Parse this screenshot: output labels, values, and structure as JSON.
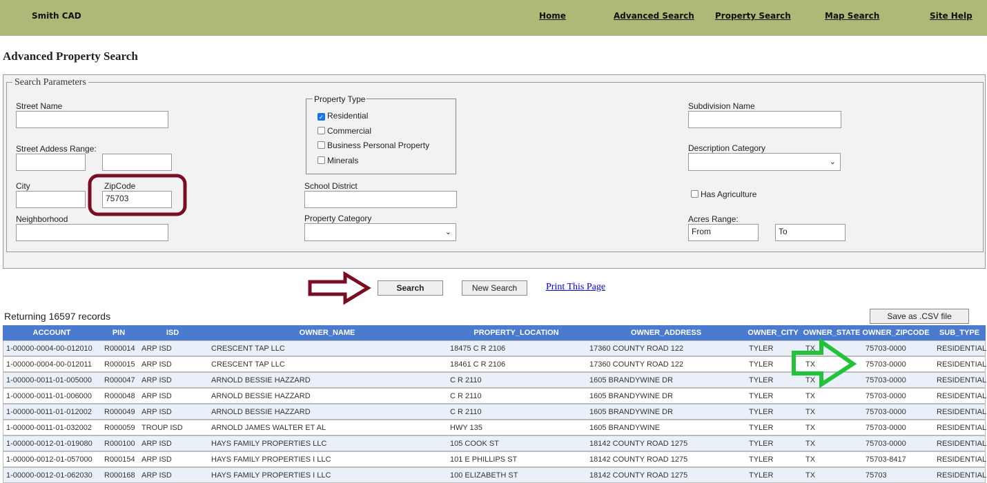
{
  "header": {
    "brand": "Smith CAD",
    "nav": [
      "Home",
      "Advanced Search",
      "Property Search",
      "Map Search",
      "Site Help"
    ]
  },
  "page_title": "Advanced Property Search",
  "form": {
    "legend": "Search Parameters",
    "street_name": {
      "label": "Street Name",
      "value": ""
    },
    "address_range": {
      "label": "Street Addess Range:",
      "from": "",
      "to": ""
    },
    "city": {
      "label": "City",
      "value": ""
    },
    "zipcode": {
      "label": "ZipCode",
      "value": "75703"
    },
    "neighborhood": {
      "label": "Neighborhood",
      "value": ""
    },
    "property_type": {
      "legend": "Property Type",
      "options": [
        {
          "label": "Residential",
          "checked": true
        },
        {
          "label": "Commercial",
          "checked": false
        },
        {
          "label": "Business Personal Property",
          "checked": false
        },
        {
          "label": "Minerals",
          "checked": false
        }
      ]
    },
    "school_district": {
      "label": "School District",
      "value": ""
    },
    "property_category": {
      "label": "Property Category",
      "value": ""
    },
    "subdivision": {
      "label": "Subdivision Name",
      "value": ""
    },
    "description_category": {
      "label": "Description Category",
      "value": ""
    },
    "has_agriculture": {
      "label": "Has Agriculture",
      "checked": false
    },
    "acres": {
      "label": "Acres Range:",
      "from_placeholder": "From",
      "to_placeholder": "To"
    }
  },
  "actions": {
    "search": "Search",
    "new_search": "New Search",
    "print": "Print This Page",
    "csv": "Save as .CSV file"
  },
  "results": {
    "count_text": "Returning 16597 records",
    "columns": [
      "ACCOUNT",
      "PIN",
      "ISD",
      "OWNER_NAME",
      "PROPERTY_LOCATION",
      "OWNER_ADDRESS",
      "OWNER_CITY",
      "OWNER_STATE",
      "OWNER_ZIPCODE",
      "SUB_TYPE"
    ],
    "rows": [
      [
        "1-00000-0004-00-012010",
        "R000014",
        "ARP ISD",
        "CRESCENT TAP LLC",
        "18475 C R 2106",
        "17360 COUNTY ROAD 122",
        "TYLER",
        "TX",
        "75703-0000",
        "RESIDENTIAL"
      ],
      [
        "1-00000-0004-00-012011",
        "R000015",
        "ARP ISD",
        "CRESCENT TAP LLC",
        "18461 C R 2106",
        "17360 COUNTY ROAD 122",
        "TYLER",
        "TX",
        "75703-0000",
        "RESIDENTIAL"
      ],
      [
        "1-00000-0011-01-005000",
        "R000047",
        "ARP ISD",
        "ARNOLD BESSIE HAZZARD",
        "C R 2110",
        "1605 BRANDYWINE DR",
        "TYLER",
        "TX",
        "75703-0000",
        "RESIDENTIAL"
      ],
      [
        "1-00000-0011-01-006000",
        "R000048",
        "ARP ISD",
        "ARNOLD BESSIE HAZZARD",
        "C R 2110",
        "1605 BRANDYWINE DR",
        "TYLER",
        "TX",
        "75703-0000",
        "RESIDENTIAL"
      ],
      [
        "1-00000-0011-01-012002",
        "R000049",
        "ARP ISD",
        "ARNOLD BESSIE HAZZARD",
        "C R 2110",
        "1605 BRANDYWINE DR",
        "TYLER",
        "TX",
        "75703-0000",
        "RESIDENTIAL"
      ],
      [
        "1-00000-0011-01-032002",
        "R000059",
        "TROUP ISD",
        "ARNOLD JAMES WALTER ET AL",
        "HWY 135",
        "1605 BRANDYWINE",
        "TYLER",
        "TX",
        "75703-0000",
        "RESIDENTIAL"
      ],
      [
        "1-00000-0012-01-019080",
        "R000100",
        "ARP ISD",
        "HAYS FAMILY PROPERTIES LLC",
        "105 COOK ST",
        "18142 COUNTY ROAD 1275",
        "TYLER",
        "TX",
        "75703-0000",
        "RESIDENTIAL"
      ],
      [
        "1-00000-0012-01-057000",
        "R000154",
        "ARP ISD",
        "HAYS FAMILY PROPERTIES I LLC",
        "101 E PHILLIPS ST",
        "18142 COUNTY ROAD 1275",
        "TYLER",
        "TX",
        "75703-8417",
        "RESIDENTIAL"
      ],
      [
        "1-00000-0012-01-062030",
        "R000168",
        "ARP ISD",
        "HAYS FAMILY PROPERTIES I LLC",
        "100 ELIZABETH ST",
        "18142 COUNTY ROAD 1275",
        "TYLER",
        "TX",
        "75703",
        "RESIDENTIAL"
      ]
    ]
  },
  "colors": {
    "header": "#adb977",
    "table_header": "#4a7bcf",
    "annotation_maroon": "#7a0d22",
    "annotation_green": "#22c33a"
  }
}
